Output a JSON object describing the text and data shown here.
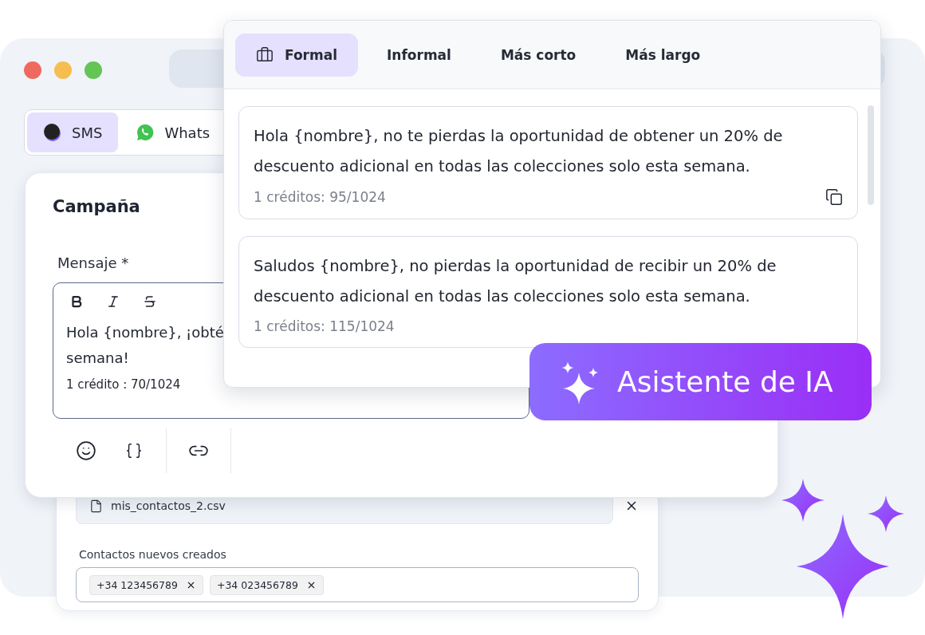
{
  "channel_tabs": [
    {
      "label": "SMS",
      "kind": "sms",
      "selected": true
    },
    {
      "label": "Whats",
      "kind": "whatsapp",
      "selected": false
    }
  ],
  "campaign": {
    "title": "Campaña",
    "message_label": "Mensaje *",
    "message_lines": [
      "Hola {nombre}, ¡obté",
      "semana!"
    ],
    "credits": "1 crédito : 70/1024"
  },
  "contacts": {
    "file_name": "mis_contactos_2.csv",
    "label": "Contactos nuevos creados",
    "chips": [
      "+34 123456789",
      "+34 023456789"
    ]
  },
  "assistant": {
    "tabs": [
      {
        "label": "Formal",
        "kind": "icon",
        "selected": true
      },
      {
        "label": "Informal",
        "kind": "plain",
        "selected": false
      },
      {
        "label": "Más corto",
        "kind": "plain",
        "selected": false
      },
      {
        "label": "Más largo",
        "kind": "plain",
        "selected": false
      }
    ],
    "suggestions": [
      {
        "text": "Hola {nombre}, no te pierdas la oportunidad de obtener un 20% de descuento adicional en todas las colecciones solo esta semana.",
        "credits": "1 créditos: 95/1024",
        "copy_icon": true
      },
      {
        "text": "Saludos {nombre}, no pierdas la oportunidad de recibir un 20% de descuento adicional en todas las colecciones solo esta semana.",
        "credits": "1 créditos: 115/1024",
        "copy_icon": false
      }
    ]
  },
  "badge": {
    "label": "Asistente de IA"
  }
}
